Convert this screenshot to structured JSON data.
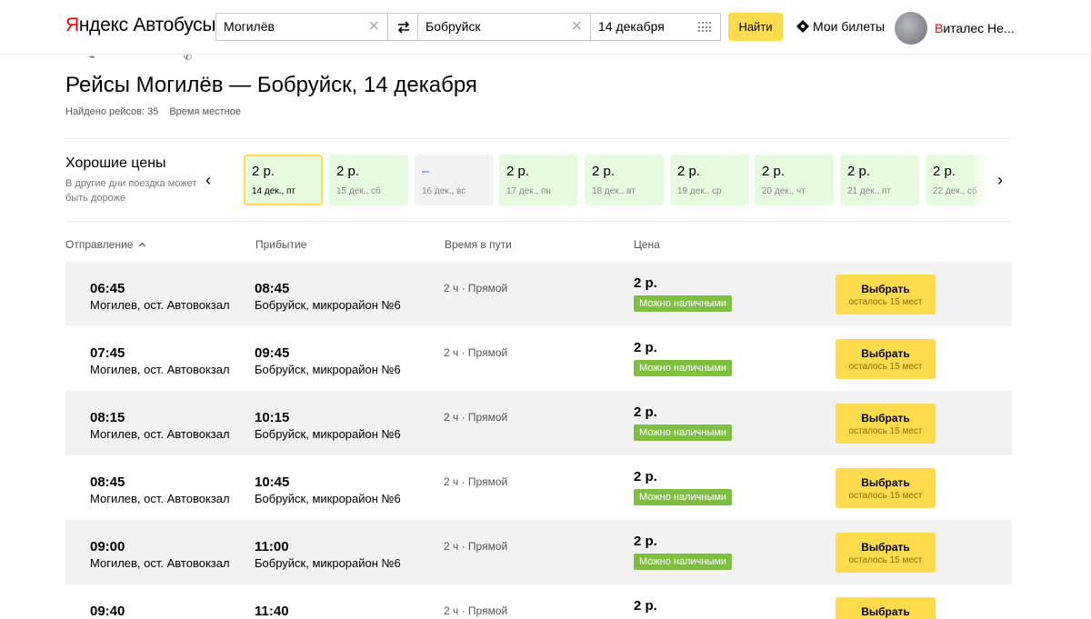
{
  "header": {
    "logo": {
      "y": "Я",
      "rest": "ндекс",
      "service": "Автобусы"
    },
    "from_value": "Могилёв",
    "to_value": "Бобруйск",
    "date_value": "14 декабря",
    "find_label": "Найти",
    "tickets_label": "Мои билеты",
    "user": {
      "first": "В",
      "rest": "италес Не..."
    }
  },
  "page": {
    "title": "Рейсы Могилёв — Бобруйск, 14 декабря",
    "found": "Найдено рейсов: 35",
    "time_note": "Время местное"
  },
  "good_prices": {
    "title": "Хорошие цены",
    "subtitle": "В другие дни поездка может быть дороже",
    "cards": [
      {
        "price": "2 р.",
        "date": "14 дек., пт",
        "state": "active"
      },
      {
        "price": "2 р.",
        "date": "15 дек., сб",
        "state": "normal"
      },
      {
        "price": "–",
        "date": "16 дек., вс",
        "state": "empty"
      },
      {
        "price": "2 р.",
        "date": "17 дек., пн",
        "state": "normal"
      },
      {
        "price": "2 р.",
        "date": "18 дек., вт",
        "state": "normal"
      },
      {
        "price": "2 р.",
        "date": "19 дек., ср",
        "state": "normal"
      },
      {
        "price": "2 р.",
        "date": "20 дек., чт",
        "state": "normal"
      },
      {
        "price": "2 р.",
        "date": "21 дек., пт",
        "state": "normal"
      },
      {
        "price": "2 р.",
        "date": "22 дек., сб",
        "state": "normal"
      }
    ]
  },
  "columns": {
    "departure": "Отправление",
    "arrival": "Прибытие",
    "duration": "Время в пути",
    "price": "Цена"
  },
  "trips": [
    {
      "dep_time": "06:45",
      "dep_place": "Могилев, ост. Автовокзал",
      "arr_time": "08:45",
      "arr_place": "Бобруйск, микрорайон №6",
      "duration": "2 ч · Прямой",
      "price": "2 р.",
      "badge": "Можно наличными",
      "button": "Выбрать",
      "seats": "осталось 15 мест"
    },
    {
      "dep_time": "07:45",
      "dep_place": "Могилев, ост. Автовокзал",
      "arr_time": "09:45",
      "arr_place": "Бобруйск, микрорайон №6",
      "duration": "2 ч · Прямой",
      "price": "2 р.",
      "badge": "Можно наличными",
      "button": "Выбрать",
      "seats": "осталось 15 мест"
    },
    {
      "dep_time": "08:15",
      "dep_place": "Могилев, ост. Автовокзал",
      "arr_time": "10:15",
      "arr_place": "Бобруйск, микрорайон №6",
      "duration": "2 ч · Прямой",
      "price": "2 р.",
      "badge": "Можно наличными",
      "button": "Выбрать",
      "seats": "осталось 15 мест"
    },
    {
      "dep_time": "08:45",
      "dep_place": "Могилев, ост. Автовокзал",
      "arr_time": "10:45",
      "arr_place": "Бобруйск, микрорайон №6",
      "duration": "2 ч · Прямой",
      "price": "2 р.",
      "badge": "Можно наличными",
      "button": "Выбрать",
      "seats": "осталось 15 мест"
    },
    {
      "dep_time": "09:00",
      "dep_place": "Могилев, ост. Автовокзал",
      "arr_time": "11:00",
      "arr_place": "Бобруйск, микрорайон №6",
      "duration": "2 ч · Прямой",
      "price": "2 р.",
      "badge": "Можно наличными",
      "button": "Выбрать",
      "seats": "осталось 15 мест"
    },
    {
      "dep_time": "09:40",
      "dep_place": "",
      "arr_time": "11:40",
      "arr_place": "",
      "duration": "2 ч · Прямой",
      "price": "2 р.",
      "badge": "",
      "button": "Выбрать",
      "seats": ""
    }
  ],
  "colors": {
    "accent_yellow": "#ffdb4d",
    "badge_green": "#7fbf3f",
    "card_green": "#e6fbe0",
    "brand_red": "#ff0000"
  }
}
